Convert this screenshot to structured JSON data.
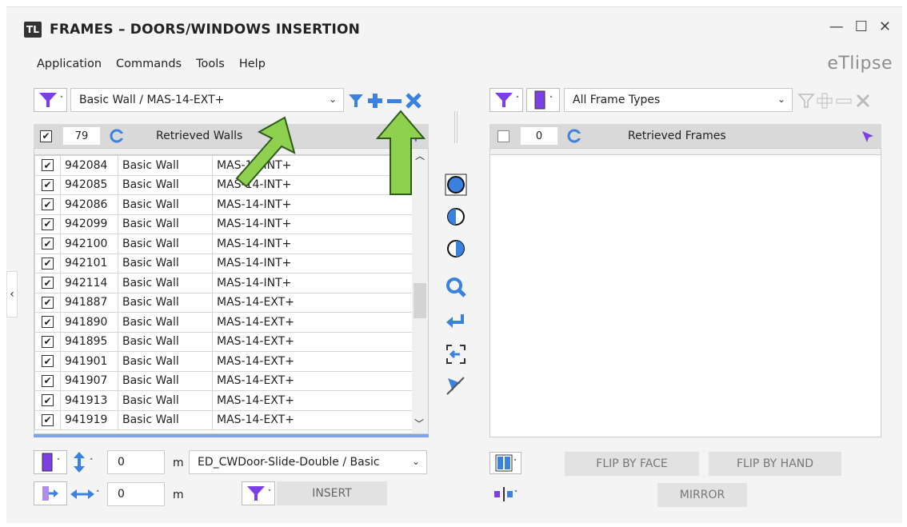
{
  "window": {
    "title": "FRAMES – DOORS/WINDOWS INSERTION",
    "minimize": "—",
    "maximize": "☐",
    "close": "✕"
  },
  "menu": [
    "Application",
    "Commands",
    "Tools",
    "Help"
  ],
  "logo": "eTlipse",
  "left": {
    "filter_value": "Basic Wall / MAS-14-EXT+",
    "count": "79",
    "header_label": "Retrieved Walls",
    "rows": [
      {
        "id": "942084",
        "type": "Basic Wall",
        "name": "MAS-14-INT+"
      },
      {
        "id": "942085",
        "type": "Basic Wall",
        "name": "MAS-14-INT+"
      },
      {
        "id": "942086",
        "type": "Basic Wall",
        "name": "MAS-14-INT+"
      },
      {
        "id": "942099",
        "type": "Basic Wall",
        "name": "MAS-14-INT+"
      },
      {
        "id": "942100",
        "type": "Basic Wall",
        "name": "MAS-14-INT+"
      },
      {
        "id": "942101",
        "type": "Basic Wall",
        "name": "MAS-14-INT+"
      },
      {
        "id": "942114",
        "type": "Basic Wall",
        "name": "MAS-14-INT+"
      },
      {
        "id": "941887",
        "type": "Basic Wall",
        "name": "MAS-14-EXT+"
      },
      {
        "id": "941890",
        "type": "Basic Wall",
        "name": "MAS-14-EXT+"
      },
      {
        "id": "941895",
        "type": "Basic Wall",
        "name": "MAS-14-EXT+"
      },
      {
        "id": "941901",
        "type": "Basic Wall",
        "name": "MAS-14-EXT+"
      },
      {
        "id": "941907",
        "type": "Basic Wall",
        "name": "MAS-14-EXT+"
      },
      {
        "id": "941913",
        "type": "Basic Wall",
        "name": "MAS-14-EXT+"
      },
      {
        "id": "941919",
        "type": "Basic Wall",
        "name": "MAS-14-EXT+"
      }
    ]
  },
  "right": {
    "filter_value": "All Frame Types",
    "count": "0",
    "header_label": "Retrieved Frames"
  },
  "bottom": {
    "offset_value": "0",
    "offset_unit": "m",
    "family_value": "ED_CWDoor-Slide-Double / Basic",
    "spacing_value": "0",
    "spacing_unit": "m",
    "insert_label": "INSERT",
    "flip_face_label": "FLIP BY FACE",
    "flip_hand_label": "FLIP BY HAND",
    "mirror_label": "MIRROR"
  },
  "colors": {
    "accent_blue": "#3b82e0",
    "accent_purple": "#7b3fe4",
    "arrow_green": "#8fd14f"
  }
}
